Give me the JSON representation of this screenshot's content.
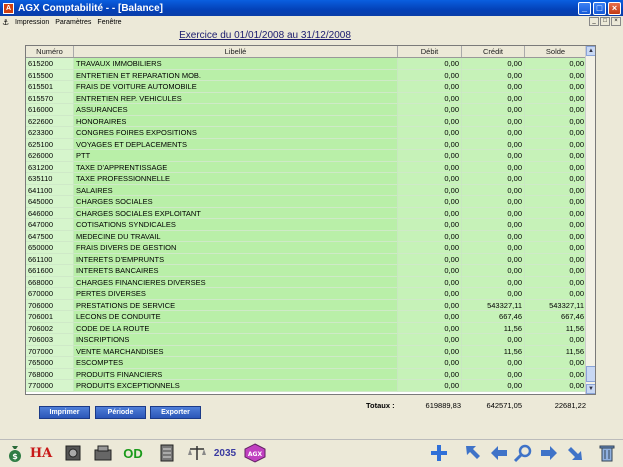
{
  "window": {
    "title": "AGX Comptabilité - - [Balance]",
    "app_icon": "A",
    "min_label": "_",
    "max_label": "□",
    "close_label": "×"
  },
  "menu": {
    "items": [
      "Impression",
      "Paramètres",
      "Fenêtre"
    ]
  },
  "page": {
    "title": "Exercice du 01/01/2008 au 31/12/2008"
  },
  "table": {
    "headers": {
      "numero": "Numéro",
      "libelle": "Libellé",
      "debit": "Débit",
      "credit": "Crédit",
      "solde": "Solde"
    },
    "rows": [
      {
        "numero": "615200",
        "libelle": "TRAVAUX IMMOBILIERS",
        "debit": "0,00",
        "credit": "0,00",
        "solde": "0,00"
      },
      {
        "numero": "615500",
        "libelle": "ENTRETIEN ET REPARATION MOB.",
        "debit": "0,00",
        "credit": "0,00",
        "solde": "0,00"
      },
      {
        "numero": "615501",
        "libelle": "FRAIS DE VOITURE AUTOMOBILE",
        "debit": "0,00",
        "credit": "0,00",
        "solde": "0,00"
      },
      {
        "numero": "615570",
        "libelle": "ENTRETIEN REP. VEHICULES",
        "debit": "0,00",
        "credit": "0,00",
        "solde": "0,00"
      },
      {
        "numero": "616000",
        "libelle": "ASSURANCES",
        "debit": "0,00",
        "credit": "0,00",
        "solde": "0,00"
      },
      {
        "numero": "622600",
        "libelle": "HONORAIRES",
        "debit": "0,00",
        "credit": "0,00",
        "solde": "0,00"
      },
      {
        "numero": "623300",
        "libelle": "CONGRES FOIRES EXPOSITIONS",
        "debit": "0,00",
        "credit": "0,00",
        "solde": "0,00"
      },
      {
        "numero": "625100",
        "libelle": "VOYAGES ET DEPLACEMENTS",
        "debit": "0,00",
        "credit": "0,00",
        "solde": "0,00"
      },
      {
        "numero": "626000",
        "libelle": "PTT",
        "debit": "0,00",
        "credit": "0,00",
        "solde": "0,00"
      },
      {
        "numero": "631200",
        "libelle": "TAXE D'APPRENTISSAGE",
        "debit": "0,00",
        "credit": "0,00",
        "solde": "0,00"
      },
      {
        "numero": "635110",
        "libelle": "TAXE PROFESSIONNELLE",
        "debit": "0,00",
        "credit": "0,00",
        "solde": "0,00"
      },
      {
        "numero": "641100",
        "libelle": "SALAIRES",
        "debit": "0,00",
        "credit": "0,00",
        "solde": "0,00"
      },
      {
        "numero": "645000",
        "libelle": "CHARGES SOCIALES",
        "debit": "0,00",
        "credit": "0,00",
        "solde": "0,00"
      },
      {
        "numero": "646000",
        "libelle": "CHARGES SOCIALES EXPLOITANT",
        "debit": "0,00",
        "credit": "0,00",
        "solde": "0,00"
      },
      {
        "numero": "647000",
        "libelle": "COTISATIONS SYNDICALES",
        "debit": "0,00",
        "credit": "0,00",
        "solde": "0,00"
      },
      {
        "numero": "647500",
        "libelle": "MEDECINE DU TRAVAIL",
        "debit": "0,00",
        "credit": "0,00",
        "solde": "0,00"
      },
      {
        "numero": "650000",
        "libelle": "FRAIS DIVERS DE GESTION",
        "debit": "0,00",
        "credit": "0,00",
        "solde": "0,00"
      },
      {
        "numero": "661100",
        "libelle": "INTERETS D'EMPRUNTS",
        "debit": "0,00",
        "credit": "0,00",
        "solde": "0,00"
      },
      {
        "numero": "661600",
        "libelle": "INTERETS BANCAIRES",
        "debit": "0,00",
        "credit": "0,00",
        "solde": "0,00"
      },
      {
        "numero": "668000",
        "libelle": "CHARGES FINANCIERES DIVERSES",
        "debit": "0,00",
        "credit": "0,00",
        "solde": "0,00"
      },
      {
        "numero": "670000",
        "libelle": "PERTES DIVERSES",
        "debit": "0,00",
        "credit": "0,00",
        "solde": "0,00"
      },
      {
        "numero": "706000",
        "libelle": "PRESTATIONS DE SERVICE",
        "debit": "0,00",
        "credit": "543327,11",
        "solde": "543327,11"
      },
      {
        "numero": "706001",
        "libelle": "LECONS DE CONDUITE",
        "debit": "0,00",
        "credit": "667,46",
        "solde": "667,46"
      },
      {
        "numero": "706002",
        "libelle": "CODE DE LA ROUTE",
        "debit": "0,00",
        "credit": "11,56",
        "solde": "11,56"
      },
      {
        "numero": "706003",
        "libelle": "INSCRIPTIONS",
        "debit": "0,00",
        "credit": "0,00",
        "solde": "0,00"
      },
      {
        "numero": "707000",
        "libelle": "VENTE MARCHANDISES",
        "debit": "0,00",
        "credit": "11,56",
        "solde": "11,56"
      },
      {
        "numero": "765000",
        "libelle": "ESCOMPTES",
        "debit": "0,00",
        "credit": "0,00",
        "solde": "0,00"
      },
      {
        "numero": "768000",
        "libelle": "PRODUITS FINANCIERS",
        "debit": "0,00",
        "credit": "0,00",
        "solde": "0,00"
      },
      {
        "numero": "770000",
        "libelle": "PRODUITS EXCEPTIONNELS",
        "debit": "0,00",
        "credit": "0,00",
        "solde": "0,00"
      }
    ]
  },
  "totals": {
    "label": "Totaux :",
    "debit": "619889,83",
    "credit": "642571,05",
    "solde": "22681,22"
  },
  "actions": {
    "print": "Imprimer",
    "period": "Période",
    "export": "Exporter"
  },
  "toolbar": {
    "ha_label": "HA",
    "od_label": "OD",
    "year_label": "2035",
    "agx_label": "AGX",
    "icons": [
      "money-bag-icon",
      "ha-journal-icon",
      "safe-icon",
      "cash-register-icon",
      "od-journal-icon",
      "ledger-icon",
      "scales-icon",
      "year-icon",
      "agx-logo-icon",
      "add-icon",
      "first-record-icon",
      "previous-record-icon",
      "search-icon",
      "next-record-icon",
      "last-record-icon",
      "delete-icon"
    ]
  },
  "colors": {
    "row_bg": "#b9efa8",
    "title_bar": "#0a5fe0",
    "button_bg": "#2b56b8"
  }
}
